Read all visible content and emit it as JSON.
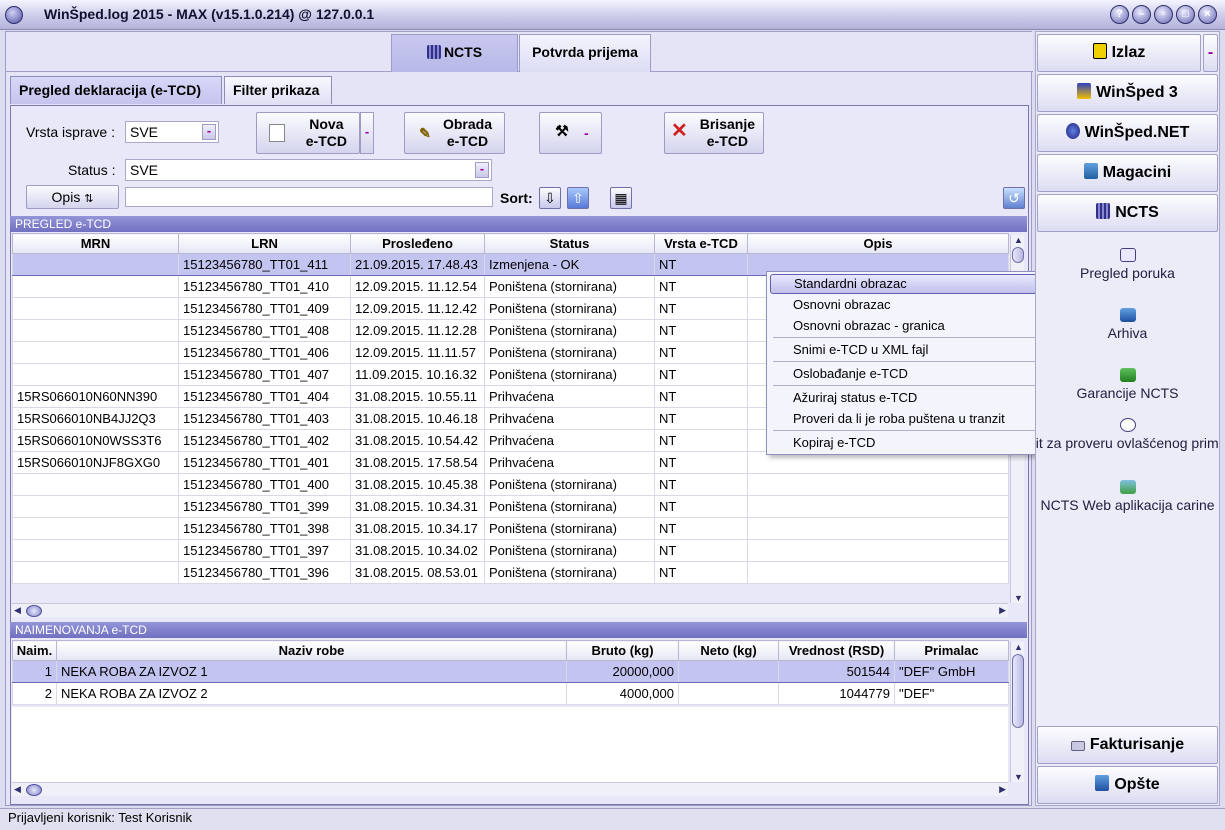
{
  "window": {
    "title": "WinŠped.log 2015 - MAX (v15.1.0.214) @ 127.0.0.1"
  },
  "top_tabs": [
    {
      "label": "NCTS"
    },
    {
      "label": "Potvrda prijema"
    }
  ],
  "sub_tabs": [
    {
      "label": "Pregled deklaracija (e-TCD)"
    },
    {
      "label": "Filter prikaza"
    }
  ],
  "filters": {
    "vrsta_label": "Vrsta isprave :",
    "vrsta_value": "SVE",
    "status_label": "Status :",
    "status_value": "SVE",
    "opis_button": "Opis",
    "opis_value": "",
    "sort_label": "Sort:"
  },
  "toolbar": {
    "nova_l1": "Nova",
    "nova_l2": "e-TCD",
    "obrada_l1": "Obrada",
    "obrada_l2": "e-TCD",
    "brisanje_l1": "Brisanje",
    "brisanje_l2": "e-TCD"
  },
  "pregled": {
    "section_title": "PREGLED e-TCD",
    "columns": [
      "MRN",
      "LRN",
      "Prosleđeno",
      "Status",
      "Vrsta e-TCD",
      "Opis"
    ],
    "rows": [
      {
        "mrn": "",
        "lrn": "15123456780_TT01_411",
        "date": "21.09.2015. 17.48.43",
        "status": "Izmenjena - OK",
        "vrsta": "NT",
        "opis": ""
      },
      {
        "mrn": "",
        "lrn": "15123456780_TT01_410",
        "date": "12.09.2015. 11.12.54",
        "status": "Poništena (stornirana)",
        "vrsta": "NT",
        "opis": ""
      },
      {
        "mrn": "",
        "lrn": "15123456780_TT01_409",
        "date": "12.09.2015. 11.12.42",
        "status": "Poništena (stornirana)",
        "vrsta": "NT",
        "opis": ""
      },
      {
        "mrn": "",
        "lrn": "15123456780_TT01_408",
        "date": "12.09.2015. 11.12.28",
        "status": "Poništena (stornirana)",
        "vrsta": "NT",
        "opis": ""
      },
      {
        "mrn": "",
        "lrn": "15123456780_TT01_406",
        "date": "12.09.2015. 11.11.57",
        "status": "Poništena (stornirana)",
        "vrsta": "NT",
        "opis": ""
      },
      {
        "mrn": "",
        "lrn": "15123456780_TT01_407",
        "date": "11.09.2015. 10.16.32",
        "status": "Poništena (stornirana)",
        "vrsta": "NT",
        "opis": ""
      },
      {
        "mrn": "15RS066010N60NN390",
        "lrn": "15123456780_TT01_404",
        "date": "31.08.2015. 10.55.11",
        "status": "Prihvaćena",
        "vrsta": "NT",
        "opis": ""
      },
      {
        "mrn": "15RS066010NB4JJ2Q3",
        "lrn": "15123456780_TT01_403",
        "date": "31.08.2015. 10.46.18",
        "status": "Prihvaćena",
        "vrsta": "NT",
        "opis": ""
      },
      {
        "mrn": "15RS066010N0WSS3T6",
        "lrn": "15123456780_TT01_402",
        "date": "31.08.2015. 10.54.42",
        "status": "Prihvaćena",
        "vrsta": "NT",
        "opis": ""
      },
      {
        "mrn": "15RS066010NJF8GXG0",
        "lrn": "15123456780_TT01_401",
        "date": "31.08.2015. 17.58.54",
        "status": "Prihvaćena",
        "vrsta": "NT",
        "opis": ""
      },
      {
        "mrn": "",
        "lrn": "15123456780_TT01_400",
        "date": "31.08.2015. 10.45.38",
        "status": "Poništena (stornirana)",
        "vrsta": "NT",
        "opis": ""
      },
      {
        "mrn": "",
        "lrn": "15123456780_TT01_399",
        "date": "31.08.2015. 10.34.31",
        "status": "Poništena (stornirana)",
        "vrsta": "NT",
        "opis": ""
      },
      {
        "mrn": "",
        "lrn": "15123456780_TT01_398",
        "date": "31.08.2015. 10.34.17",
        "status": "Poništena (stornirana)",
        "vrsta": "NT",
        "opis": ""
      },
      {
        "mrn": "",
        "lrn": "15123456780_TT01_397",
        "date": "31.08.2015. 10.34.02",
        "status": "Poništena (stornirana)",
        "vrsta": "NT",
        "opis": ""
      },
      {
        "mrn": "",
        "lrn": "15123456780_TT01_396",
        "date": "31.08.2015. 08.53.01",
        "status": "Poništena (stornirana)",
        "vrsta": "NT",
        "opis": ""
      }
    ]
  },
  "naimenovanja": {
    "section_title": "NAIMENOVANJA e-TCD",
    "columns": [
      "Naim.",
      "Naziv robe",
      "Bruto (kg)",
      "Neto (kg)",
      "Vrednost (RSD)",
      "Primalac"
    ],
    "rows": [
      {
        "naim": "1",
        "naziv": "NEKA ROBA ZA IZVOZ 1",
        "bruto": "20000,000",
        "neto": "",
        "vrednost": "501544",
        "primalac": "\"DEF\" GmbH"
      },
      {
        "naim": "2",
        "naziv": "NEKA ROBA ZA IZVOZ 2",
        "bruto": "4000,000",
        "neto": "",
        "vrednost": "1044779",
        "primalac": "\"DEF\""
      }
    ]
  },
  "context_menu": {
    "items": [
      "Standardni obrazac",
      "Osnovni obrazac",
      "Osnovni obrazac - granica",
      "Snimi e-TCD u XML fajl",
      "Oslobađanje e-TCD",
      "Ažuriraj status e-TCD",
      "Proveri da li je roba puštena u tranzit",
      "Kopiraj e-TCD"
    ]
  },
  "sidebar": {
    "buttons": [
      "Izlaz",
      "WinŠped 3",
      "WinŠped.NET",
      "Magacini",
      "NCTS"
    ],
    "links": [
      "Pregled poruka",
      "Arhiva",
      "Garancije NCTS",
      "pit za proveru ovlašćenog primaoca",
      "NCTS Web aplikacija carine"
    ],
    "bottom_buttons": [
      "Fakturisanje",
      "Opšte"
    ]
  },
  "status_bar": {
    "text": "Prijavljeni korisnik: Test Korisnik"
  },
  "colors": {
    "selection": "#c4c4f0",
    "section_bar": "#7c7cc8",
    "accent_purple": "#a000a0"
  }
}
